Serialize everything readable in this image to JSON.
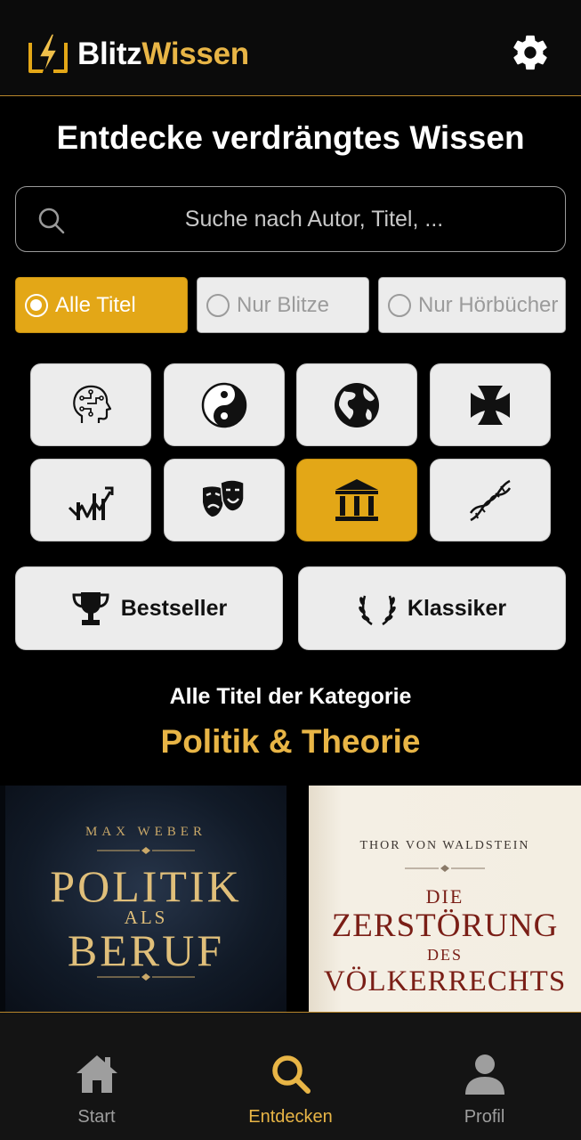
{
  "header": {
    "logo_word1": "Blitz",
    "logo_word2": "Wissen",
    "logo_icon": "lightning-bolt-icon",
    "settings_icon": "gear-icon"
  },
  "page_title": "Entdecke verdrängtes Wissen",
  "search": {
    "placeholder": "Suche nach Autor, Titel, ...",
    "value": ""
  },
  "filters": [
    {
      "label": "Alle Titel",
      "selected": true
    },
    {
      "label": "Nur Blitze",
      "selected": false
    },
    {
      "label": "Nur Hörbücher",
      "selected": false
    }
  ],
  "categories": [
    {
      "icon": "brain-head-icon",
      "selected": false
    },
    {
      "icon": "yin-yang-icon",
      "selected": false
    },
    {
      "icon": "globe-icon",
      "selected": false
    },
    {
      "icon": "iron-cross-icon",
      "selected": false
    },
    {
      "icon": "trend-chart-icon",
      "selected": false
    },
    {
      "icon": "theater-masks-icon",
      "selected": false
    },
    {
      "icon": "columns-building-icon",
      "selected": true
    },
    {
      "icon": "dna-icon",
      "selected": false
    }
  ],
  "buttons": {
    "bestseller": "Bestseller",
    "klassiker": "Klassiker"
  },
  "section": {
    "subtitle": "Alle Titel der Kategorie",
    "category_name": "Politik & Theorie"
  },
  "books": [
    {
      "author": "MAX WEBER",
      "title_line1": "POLITIK",
      "title_line2": "ALS",
      "title_line3": "BERUF"
    },
    {
      "author": "THOR VON WALDSTEIN",
      "title_line1": "DIE",
      "title_line2": "ZERSTÖRUNG",
      "title_line3": "DES",
      "title_line4": "VÖLKERRECHTS"
    }
  ],
  "nav": [
    {
      "label": "Start",
      "icon": "home-icon",
      "active": false
    },
    {
      "label": "Entdecken",
      "icon": "search-icon",
      "active": true
    },
    {
      "label": "Profil",
      "icon": "person-icon",
      "active": false
    }
  ],
  "colors": {
    "accent": "#e3a717",
    "gold_text": "#e8b546",
    "background": "#000000"
  }
}
